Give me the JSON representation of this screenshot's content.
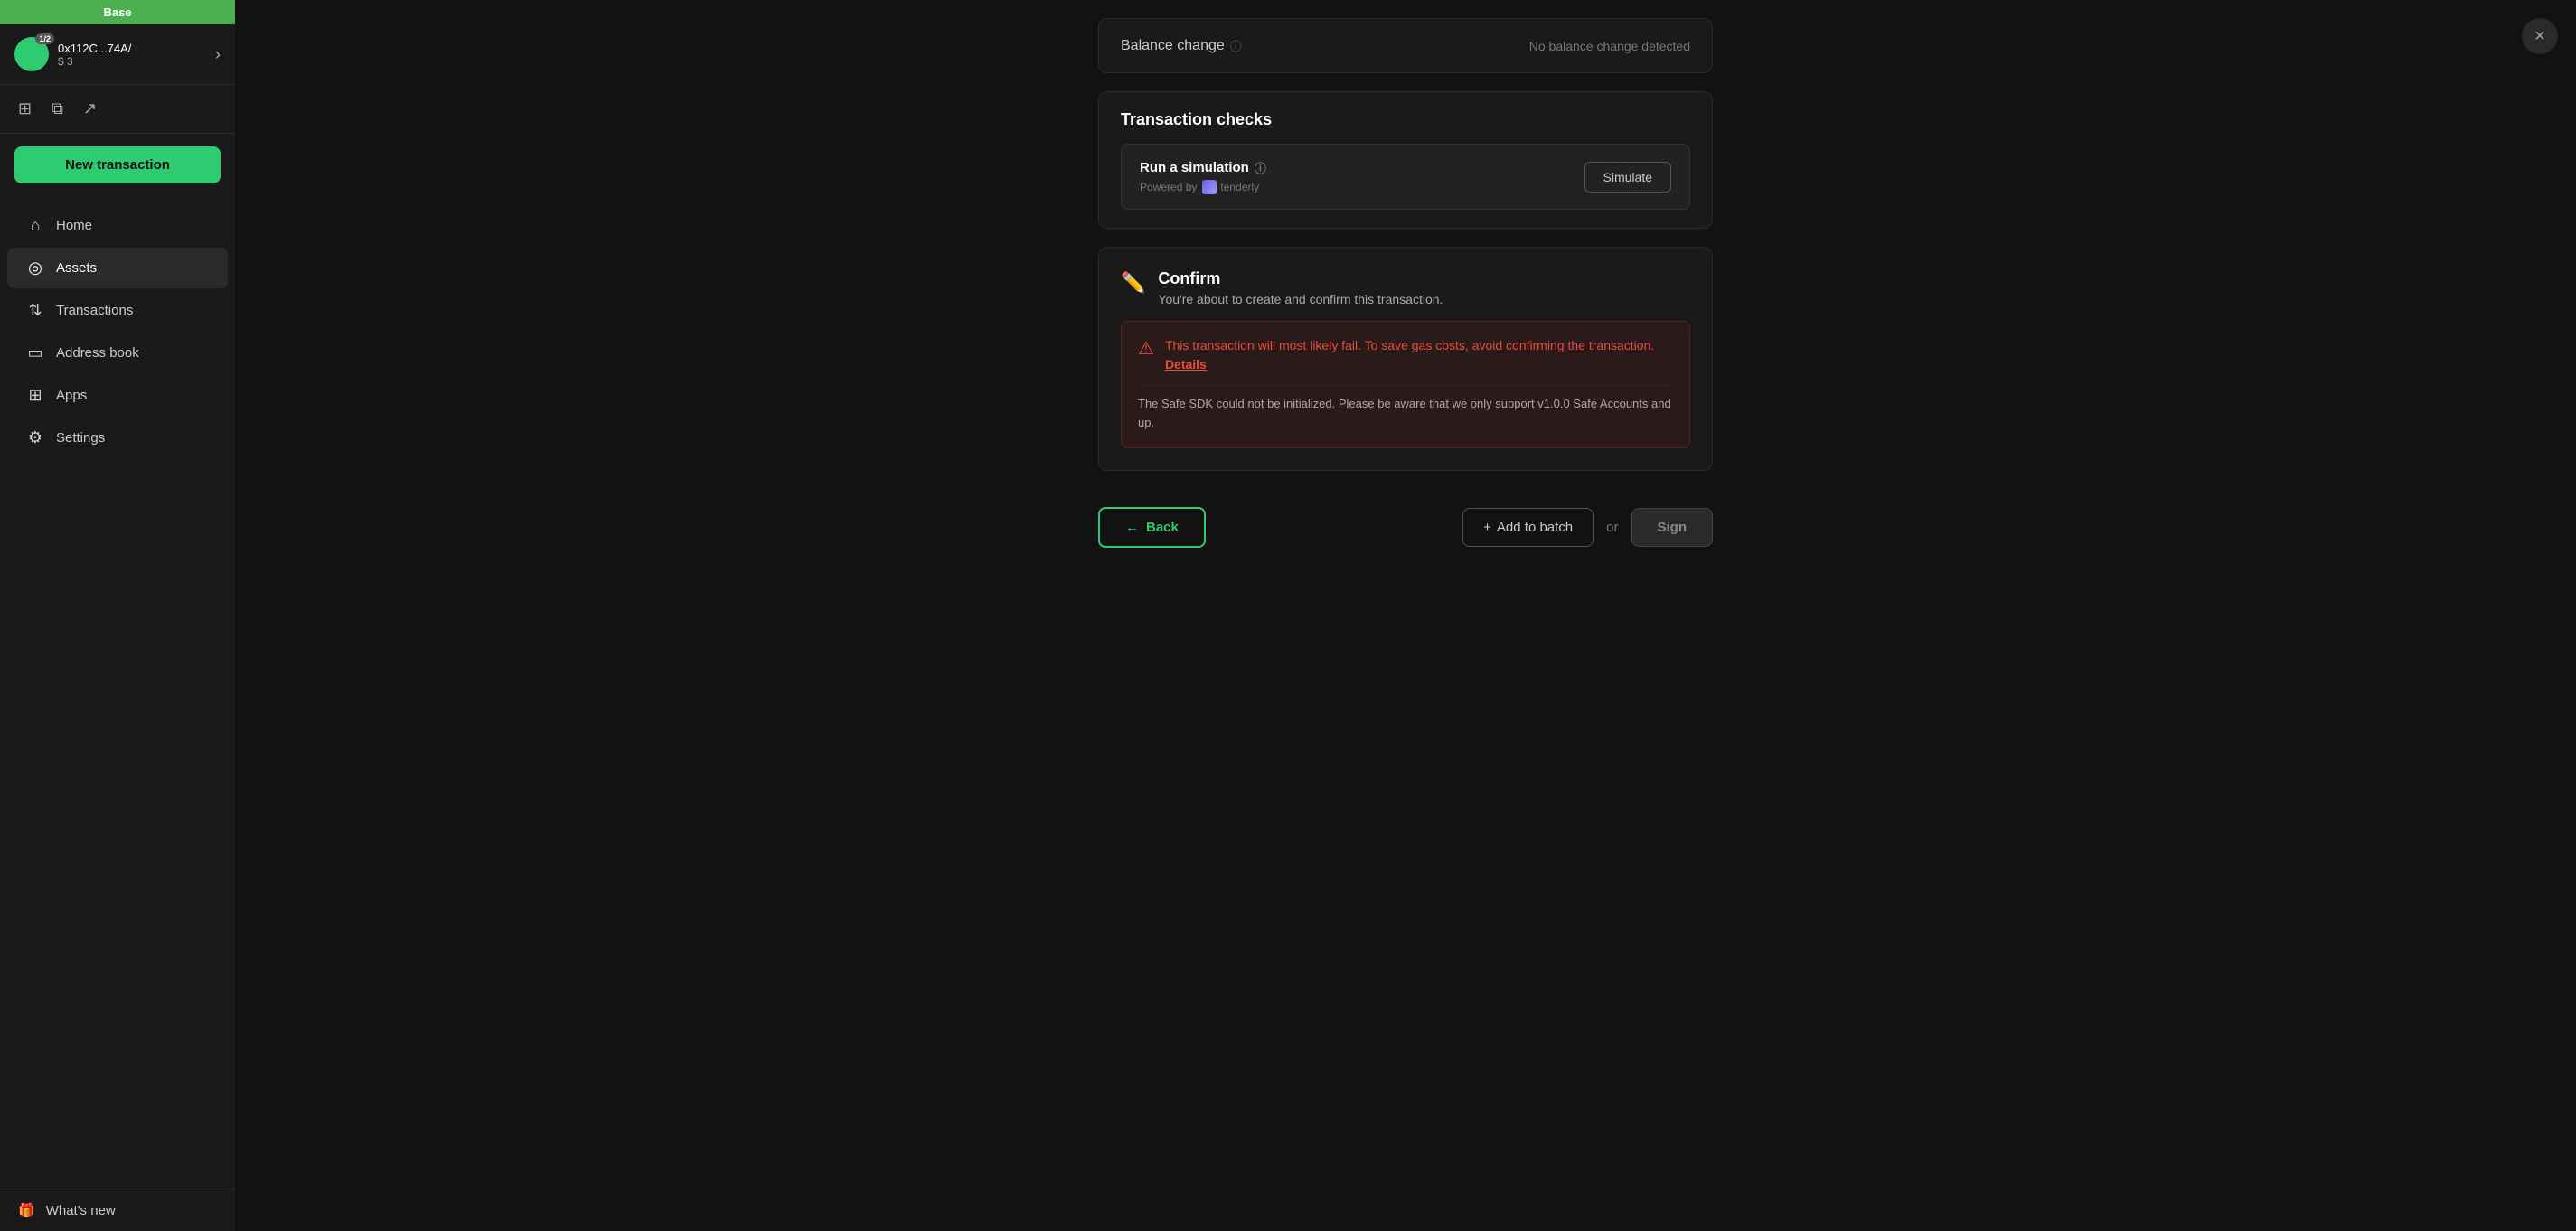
{
  "sidebar": {
    "top_bar_label": "Base",
    "account": {
      "badge": "1/2",
      "address": "0x112C...74A/",
      "balance": "$ 3"
    },
    "icons": [
      {
        "name": "grid-icon",
        "symbol": "⊞"
      },
      {
        "name": "copy-icon",
        "symbol": "⧉"
      },
      {
        "name": "external-link-icon",
        "symbol": "↗"
      }
    ],
    "new_transaction_label": "New transaction",
    "expand_icon": "›",
    "nav_items": [
      {
        "id": "home",
        "label": "Home",
        "icon": "⌂",
        "active": false
      },
      {
        "id": "assets",
        "label": "Assets",
        "icon": "◎",
        "active": true
      },
      {
        "id": "transactions",
        "label": "Transactions",
        "icon": "⇅",
        "active": false
      },
      {
        "id": "address-book",
        "label": "Address book",
        "icon": "▭",
        "active": false
      },
      {
        "id": "apps",
        "label": "Apps",
        "icon": "⊞",
        "active": false
      },
      {
        "id": "settings",
        "label": "Settings",
        "icon": "⚙",
        "active": false
      }
    ],
    "whats_new": {
      "icon": "🎁",
      "label": "What's new"
    }
  },
  "main": {
    "balance_change": {
      "title": "Balance change",
      "no_change_text": "No balance change detected"
    },
    "transaction_checks": {
      "title": "Transaction checks",
      "simulation": {
        "label": "Run a simulation",
        "powered_by": "Powered by",
        "provider": "tenderly",
        "simulate_btn": "Simulate"
      }
    },
    "confirm": {
      "title": "Confirm",
      "subtitle": "You're about to create and confirm this transaction.",
      "warning": {
        "main_text": "This transaction will most likely fail. To save gas costs, avoid confirming the transaction.",
        "details_link": "Details",
        "description": "The Safe SDK could not be initialized. Please be aware that we only support v1.0.0 Safe Accounts and up."
      }
    },
    "actions": {
      "back_label": "Back",
      "back_arrow": "←",
      "add_batch_label": "Add to batch",
      "add_batch_icon": "+",
      "or_label": "or",
      "sign_label": "Sign"
    }
  },
  "close_btn_label": "×"
}
